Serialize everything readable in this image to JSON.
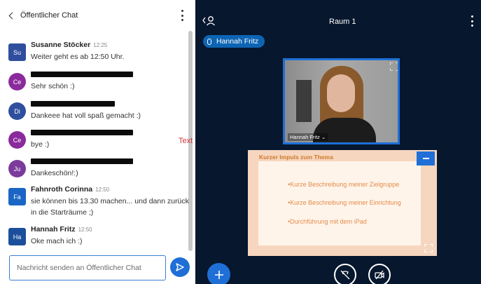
{
  "chat": {
    "title": "Öffentlicher Chat",
    "messages": [
      {
        "initials": "Su",
        "name": "Susanne Stöcker",
        "time": "12:25",
        "text": "Weiter geht es ab 12:50 Uhr.",
        "color": "#2f4e9e"
      },
      {
        "initials": "Ce",
        "text": "Sehr schön :)",
        "color": "#8b2a9c"
      },
      {
        "initials": "Di",
        "text": "Dankeee hat voll spaß gemacht :)",
        "color": "#2f4e9e"
      },
      {
        "initials": "Ce",
        "text": "bye :)",
        "color": "#8b2a9c"
      },
      {
        "initials": "Ju",
        "text": "Dankeschön!:)",
        "color": "#7b3a9c"
      },
      {
        "initials": "Fa",
        "name": "Fahnroth Corinna",
        "time": "12:50",
        "text": "sie können bis 13.30 machen... und dann zurück in die Starträume ;)",
        "color": "#1b66c4"
      },
      {
        "initials": "Ha",
        "name": "Hannah Fritz",
        "time": "12:50",
        "text": "Oke mach ich :)",
        "color": "#1b4f9c"
      }
    ],
    "input_placeholder": "Nachricht senden an Öffentlicher Chat",
    "annotation": "Text"
  },
  "meeting": {
    "room": "Raum 1",
    "talking": "Hannah Fritz",
    "video_label": "Hannah Fritz ⌄",
    "presentation": {
      "title": "Kurzer Impuls zum Thema",
      "bullets": [
        "•Kurze Beschreibung meiner Zielgruppe",
        "•Kurze Beschreibung meiner Einrichtung",
        "•Durchführung mit dem iPad"
      ]
    }
  },
  "colors": {
    "accent": "#1f6fd6",
    "meeting_bg": "#06172e",
    "slide_accent": "#e38c4a"
  },
  "icons": [
    "chevron-left-icon",
    "kebab-menu-icon",
    "send-icon",
    "user-icon",
    "microphone-icon",
    "expand-icon",
    "minimize-icon",
    "plus-icon",
    "mute-icon",
    "camera-off-icon"
  ]
}
